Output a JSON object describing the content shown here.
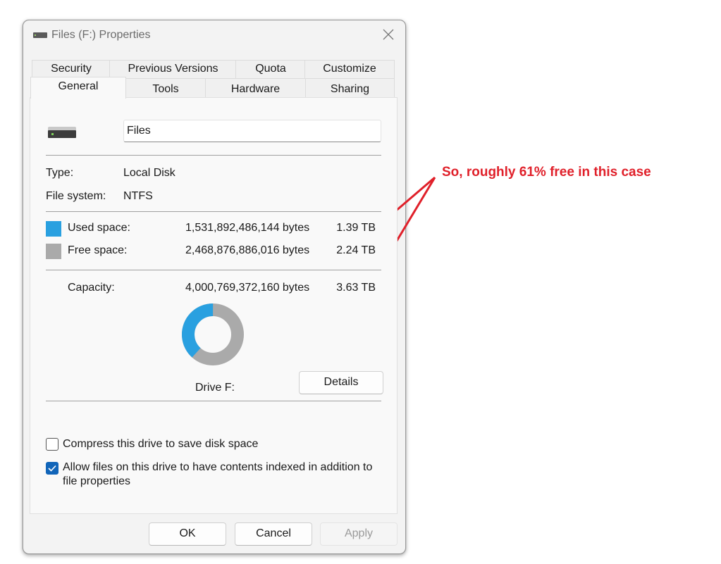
{
  "window": {
    "title": "Files (F:) Properties",
    "title_icon": "drive-icon",
    "close_icon": "close-icon"
  },
  "tabs": {
    "back_row": [
      "Security",
      "Previous Versions",
      "Quota",
      "Customize"
    ],
    "front_row": [
      "General",
      "Tools",
      "Hardware",
      "Sharing"
    ],
    "active": "General"
  },
  "general": {
    "drive_icon": "hard-drive-icon",
    "name_value": "Files",
    "type_label": "Type:",
    "type_value": "Local Disk",
    "fs_label": "File system:",
    "fs_value": "NTFS",
    "used": {
      "label": "Used space:",
      "bytes": "1,531,892,486,144 bytes",
      "size": "1.39 TB",
      "color": "#29a0e0"
    },
    "free": {
      "label": "Free space:",
      "bytes": "2,468,876,886,016 bytes",
      "size": "2.24 TB",
      "color": "#aaaaaa"
    },
    "capacity": {
      "label": "Capacity:",
      "bytes": "4,000,769,372,160 bytes",
      "size": "3.63 TB"
    },
    "used_fraction": 0.383,
    "drive_label": "Drive F:",
    "details_label": "Details",
    "compress": {
      "label": "Compress this drive to save disk space",
      "checked": false
    },
    "index": {
      "label_line1": "Allow files on this drive to have contents indexed in addition to",
      "label_line2": "file properties",
      "checked": true
    }
  },
  "buttons": {
    "ok": "OK",
    "cancel": "Cancel",
    "apply": "Apply"
  },
  "annotation": {
    "text": "So, roughly 61% free in this case",
    "color": "#e0202a"
  }
}
